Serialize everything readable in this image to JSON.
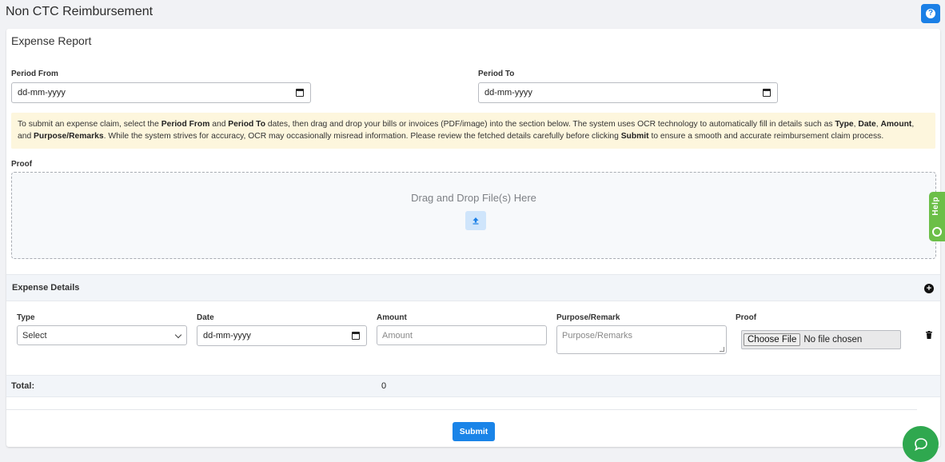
{
  "page": {
    "title": "Non CTC Reimbursement",
    "help_button": "?"
  },
  "card": {
    "title": "Expense Report",
    "period_from": {
      "label": "Period From",
      "placeholder": "dd-mm-yyyy"
    },
    "period_to": {
      "label": "Period To",
      "placeholder": "dd-mm-yyyy"
    },
    "info": {
      "p1": "To submit an expense claim, select the ",
      "b1": "Period From",
      "p2": " and ",
      "b2": "Period To",
      "p3": " dates, then drag and drop your bills or invoices (PDF/image) into the section below. The system uses OCR technology to automatically fill in details such as ",
      "b3": "Type",
      "p4": ", ",
      "b4": "Date",
      "p5": ", ",
      "b5": "Amount",
      "p6": ", and ",
      "b6": "Purpose/Remarks",
      "p7": ". While the system strives for accuracy, OCR may occasionally misread information. Please review the fetched details carefully before clicking ",
      "b7": "Submit",
      "p8": " to ensure a smooth and accurate reimbursement claim process."
    },
    "proof_label": "Proof",
    "dropzone_text": "Drag and Drop File(s) Here"
  },
  "side_help": {
    "label": "Help"
  },
  "expense_details": {
    "title": "Expense Details",
    "columns": {
      "type": "Type",
      "date": "Date",
      "amount": "Amount",
      "purpose": "Purpose/Remark",
      "proof": "Proof"
    },
    "row": {
      "type_value": "Select",
      "date_placeholder": "dd-mm-yyyy",
      "amount_placeholder": "Amount",
      "purpose_placeholder": "Purpose/Remarks",
      "file_button": "Choose File",
      "file_status": "No file chosen"
    }
  },
  "total": {
    "label": "Total:",
    "value": "0"
  },
  "submit_label": "Submit",
  "colors": {
    "primary": "#1a84e8",
    "info_bg": "#fdf6dd",
    "help_tab": "#6cbf48",
    "chat": "#2fa84f"
  }
}
